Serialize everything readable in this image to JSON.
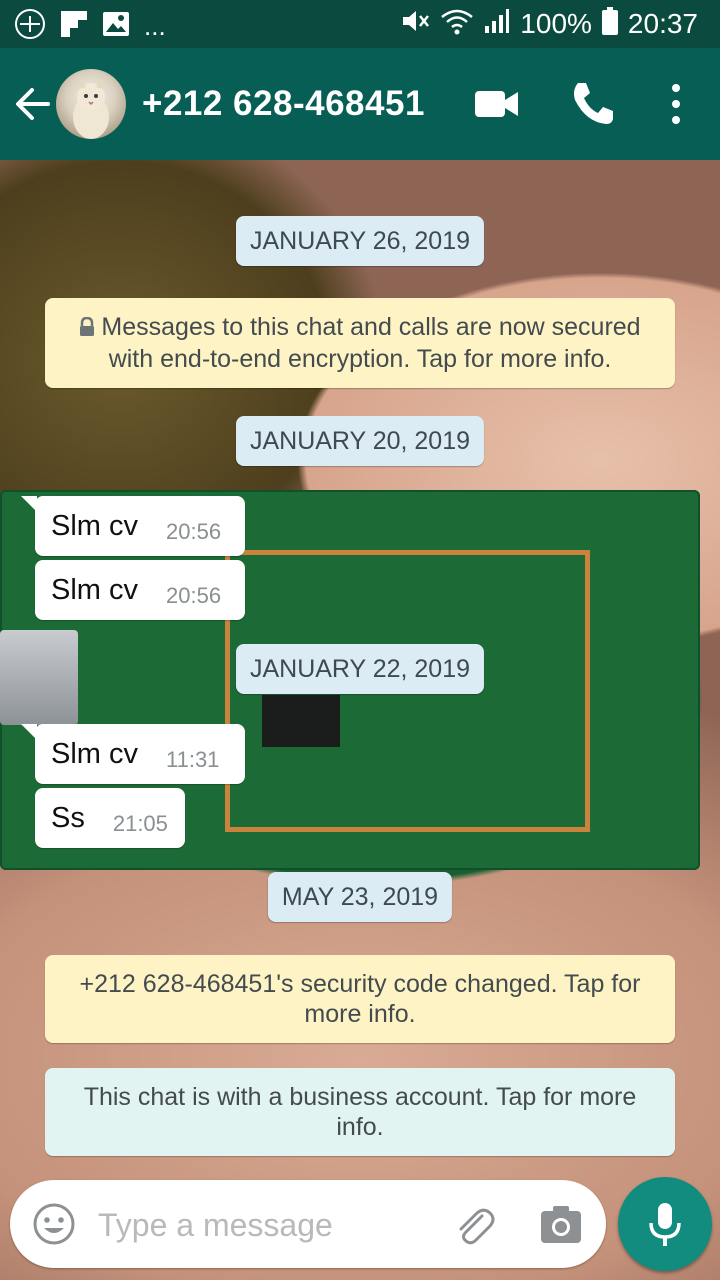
{
  "status_bar": {
    "battery": "100%",
    "time": "20:37",
    "more_indicator": "..."
  },
  "header": {
    "contact_name": "+212 628-468451"
  },
  "chat": {
    "date_1": "JANUARY 26, 2019",
    "encryption_notice": "Messages to this chat and calls are now secured with end-to-end encryption. Tap for more info.",
    "date_2": "JANUARY 20, 2019",
    "messages_a": [
      {
        "text": "Slm cv",
        "time": "20:56"
      },
      {
        "text": "Slm cv",
        "time": "20:56"
      }
    ],
    "date_3": "JANUARY 22, 2019",
    "messages_b": [
      {
        "text": "Slm cv",
        "time": "11:31"
      },
      {
        "text": "Ss",
        "time": "21:05"
      }
    ],
    "date_4": "MAY 23, 2019",
    "security_notice": "+212 628-468451's security code changed. Tap for more info.",
    "business_notice": "This chat is with a business account. Tap for more info."
  },
  "input": {
    "placeholder": "Type a message"
  },
  "colors": {
    "header": "#075e54",
    "status_bar": "#0b4a3f",
    "mic_button": "#128c7e",
    "system_yellow": "#fdf3c4",
    "system_teal": "#e2f4f1",
    "date_chip": "#dcecf5"
  },
  "icons": {
    "back": "arrow-left-icon",
    "video": "video-camera-icon",
    "call": "phone-icon",
    "menu": "more-vertical-icon",
    "emoji": "emoji-icon",
    "attach": "paperclip-icon",
    "camera": "camera-icon",
    "mic": "microphone-icon",
    "lock": "lock-icon"
  }
}
